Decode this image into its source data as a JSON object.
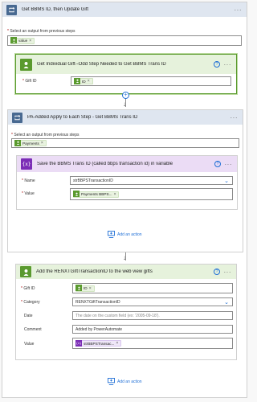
{
  "colors": {
    "foreach_header": "#dfe6f0",
    "foreach_icon": "#486991",
    "action_header": "#e6f2dc",
    "action_border": "#5a9a2e",
    "action_icon": "#5a9a2e",
    "variable_header": "#ebdcf5",
    "variable_icon": "#7b2db6",
    "link_blue": "#1f6fd6"
  },
  "outer_loop": {
    "title": "Get BBMS ID, then Update Gift",
    "more": "···",
    "select_label": "Select an output from previous steps",
    "token": {
      "icon": "bbms-icon",
      "text": "value"
    },
    "get_gift_action": {
      "title": "Get Individual Gift--Odd Step Needed to Get BBMS Trans ID",
      "help": "?",
      "more": "···",
      "field_label": "Gift ID",
      "token": {
        "icon": "bbms-icon",
        "text": "ID"
      }
    },
    "inner_loop": {
      "title": "PA-Added Apply to Each Step - Get BBMS Trans ID",
      "more": "···",
      "select_label": "Select an output from previous steps",
      "token": {
        "icon": "bbms-icon",
        "text": "Payments"
      },
      "variable_action": {
        "title": "Save the BBMS Trans ID (called bbps transaction id) in variable",
        "help": "?",
        "more": "···",
        "name_label": "Name",
        "name_value": "strBBPSTransactionID",
        "value_label": "Value",
        "value_token": {
          "icon": "bbms-icon",
          "text": "Payments BBPS..."
        }
      },
      "add_action_label": "Add an action"
    },
    "update_action": {
      "title": "Add the RENXTGiftTransactionID to the web view gifts",
      "help": "?",
      "more": "···",
      "gift_id_label": "Gift ID",
      "gift_id_token": {
        "icon": "bbms-icon",
        "text": "ID"
      },
      "category_label": "Category",
      "category_value": "RENXTGiftTransactionID",
      "date_label": "Date",
      "date_placeholder": "The date on the custom field (ex: '2005-09-18').",
      "comment_label": "Comment",
      "comment_value": "Added by PowerAutomate",
      "value_label": "Value",
      "value_token": {
        "icon": "variable-icon",
        "text": "strBBPSTransac..."
      }
    },
    "add_action_label": "Add an action"
  }
}
